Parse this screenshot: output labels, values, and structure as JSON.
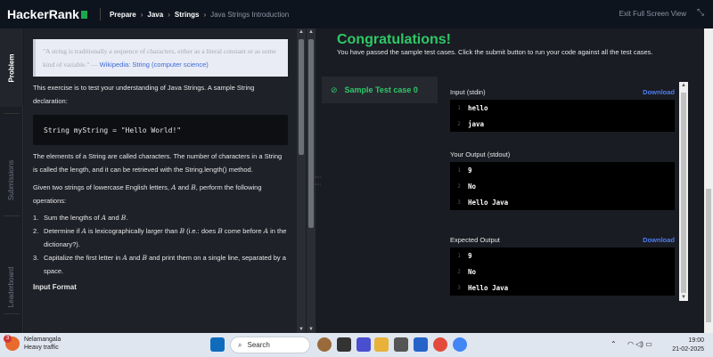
{
  "header": {
    "logo": "HackerRank",
    "breadcrumbs": [
      "Prepare",
      "Java",
      "Strings",
      "Java Strings Introduction"
    ],
    "exit_label": "Exit Full Screen View"
  },
  "tabs": [
    "Problem",
    "Submissions",
    "Leaderboard"
  ],
  "problem": {
    "quote_text": "\"A string is traditionally a sequence of characters, either as a literal constant or as some kind of variable.\" —",
    "quote_link": "Wikipedia: String (computer science)",
    "para1": "This exercise is to test your understanding of Java Strings. A sample String declaration:",
    "code": "String myString = \"Hello World!\"",
    "para2": "The elements of a String are called characters. The number of characters in a String is called the length, and it can be retrieved with the String.length() method.",
    "para3_a": "Given two strings of lowercase English letters, ",
    "para3_b": " and ",
    "para3_c": ", perform the following operations:",
    "var_a": "A",
    "var_b": "B",
    "ops": [
      {
        "num": "1.",
        "a": "Sum the lengths of ",
        "b": " and ",
        "c": "."
      },
      {
        "num": "2.",
        "a": "Determine if ",
        "b": " is lexicographically larger than ",
        "c": " (i.e.: does ",
        "d": " come before ",
        "e": " in the dictionary?)."
      },
      {
        "num": "3.",
        "a": "Capitalize the first letter in ",
        "b": " and ",
        "c": " and print them on a single line, separated by a space."
      }
    ],
    "input_heading": "Input Format"
  },
  "result": {
    "title": "Congratulations!",
    "subtitle": "You have passed the sample test cases. Click the submit button to run your code against all the test cases.",
    "testcase": "Sample Test case 0",
    "input_label": "Input (stdin)",
    "download": "Download",
    "input_lines": [
      "hello",
      "java"
    ],
    "output_label": "Your Output (stdout)",
    "output_lines": [
      "9",
      "No",
      "Hello Java"
    ],
    "expected_label": "Expected Output",
    "expected_lines": [
      "9",
      "No",
      "Hello Java"
    ]
  },
  "taskbar": {
    "weather_badge": "3",
    "weather_place": "Nelamangala",
    "weather_status": "Heavy traffic",
    "search_placeholder": "Search",
    "time": "19:00",
    "date": "21-02-2025"
  }
}
